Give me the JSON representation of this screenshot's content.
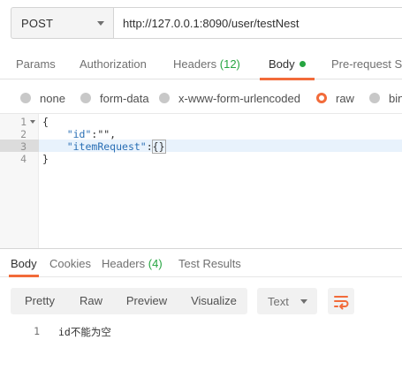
{
  "request": {
    "method": "POST",
    "url": "http://127.0.0.1:8090/user/testNest"
  },
  "req_tabs": {
    "params": "Params",
    "authorization": "Authorization",
    "headers": "Headers",
    "headers_count": "(12)",
    "body": "Body",
    "prerequest": "Pre-request Sc"
  },
  "body_types": {
    "none": "none",
    "form_data": "form-data",
    "urlencoded": "x-www-form-urlencoded",
    "raw": "raw",
    "binary": "bina",
    "selected": "raw"
  },
  "editor": {
    "line_numbers": [
      "1",
      "2",
      "3",
      "4"
    ],
    "line1": "{",
    "line2_key": "\"id\"",
    "line2_rest": ":\"\",",
    "line3_key": "\"itemRequest\"",
    "line3_colon": ":",
    "line3_value": "{}",
    "line4": "}"
  },
  "resp_tabs": {
    "body": "Body",
    "cookies": "Cookies",
    "headers": "Headers",
    "headers_count": "(4)",
    "test_results": "Test Results"
  },
  "resp_toolbar": {
    "pretty": "Pretty",
    "raw": "Raw",
    "preview": "Preview",
    "visualize": "Visualize",
    "format": "Text",
    "wrap_icon": "wrap-lines-icon"
  },
  "response": {
    "line_number": "1",
    "text": "id不能为空"
  },
  "colors": {
    "accent": "#f26b3a",
    "green": "#26a541",
    "json_key": "#2a6fb5"
  }
}
